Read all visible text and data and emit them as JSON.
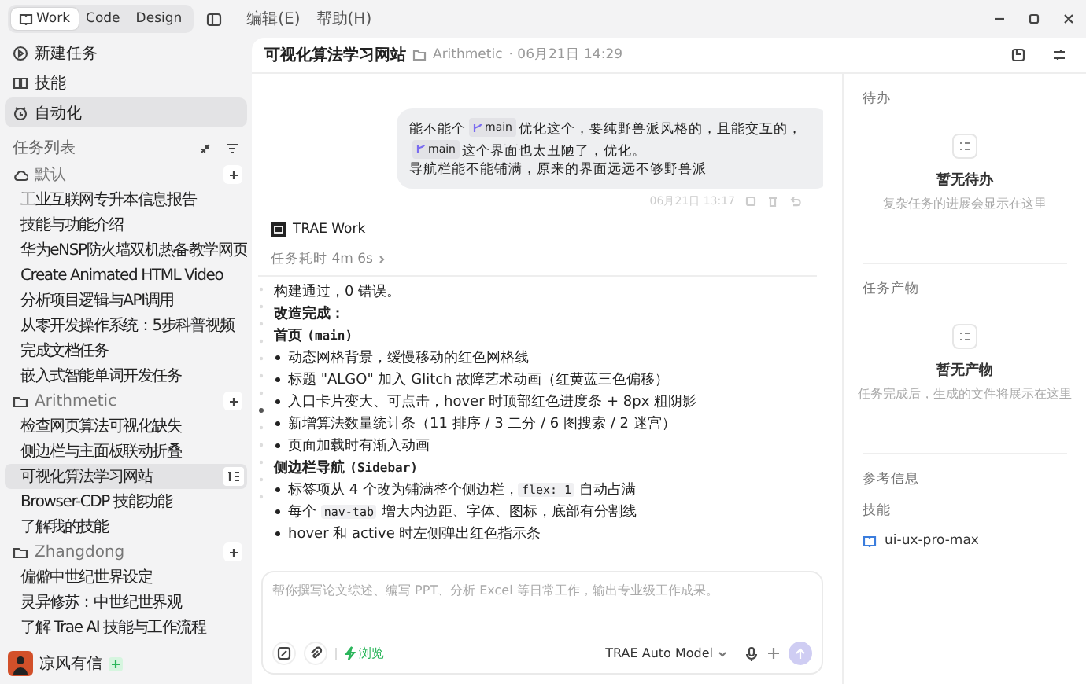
{
  "mode_tabs": [
    {
      "label": "Work",
      "selected": true
    },
    {
      "label": "Code",
      "selected": false
    },
    {
      "label": "Design",
      "selected": false
    }
  ],
  "menu": [
    "编辑(E)",
    "帮助(H)"
  ],
  "nav": [
    {
      "label": "新建任务",
      "kind": "new",
      "selected": false
    },
    {
      "label": "技能",
      "kind": "skills",
      "selected": false
    },
    {
      "label": "自动化",
      "kind": "auto",
      "selected": true
    }
  ],
  "task_list": {
    "title": "任务列表",
    "groups": [
      {
        "name": "默认",
        "kind": "cloud",
        "tasks": [
          {
            "label": "工业互联网专升本信息报告",
            "selected": false
          },
          {
            "label": "技能与功能介绍",
            "selected": false
          },
          {
            "label": "华为eNSP防火墙双机热备教学网页",
            "selected": false
          },
          {
            "label": "Create Animated HTML Video",
            "selected": false
          },
          {
            "label": "分析项目逻辑与API调用",
            "selected": false
          },
          {
            "label": "从零开发操作系统：5步科普视频",
            "selected": false
          },
          {
            "label": "完成文档任务",
            "selected": false
          },
          {
            "label": "嵌入式智能单词开发任务",
            "selected": false
          }
        ]
      },
      {
        "name": "Arithmetic",
        "kind": "folder",
        "tasks": [
          {
            "label": "检查网页算法可视化缺失",
            "selected": false
          },
          {
            "label": "侧边栏与主面板联动折叠",
            "selected": false
          },
          {
            "label": "可视化算法学习网站",
            "selected": true
          },
          {
            "label": "Browser-CDP 技能功能",
            "selected": false
          },
          {
            "label": "了解我的技能",
            "selected": false
          }
        ]
      },
      {
        "name": "Zhangdong",
        "kind": "folder",
        "tasks": [
          {
            "label": "偏僻中世纪世界设定",
            "selected": false
          },
          {
            "label": "灵异修苏：中世纪世界观",
            "selected": false
          },
          {
            "label": "了解 Trae AI 技能与工作流程",
            "selected": false
          }
        ]
      }
    ]
  },
  "user": {
    "name": "凉风有信"
  },
  "header": {
    "title": "可视化算法学习网站",
    "folder": "Arithmetic",
    "time": "· 06月21日 14:29"
  },
  "user_message": {
    "lines": [
      [
        {
          "kind": "text",
          "text": "能不能个"
        },
        {
          "kind": "chip",
          "text": "main"
        },
        {
          "kind": "text",
          "text": "优化这个，要纯野兽派风格的，且能交互的，"
        },
        {
          "kind": "chip",
          "text": "main"
        },
        {
          "kind": "text",
          "text": "这个界面也太丑陋了，优化。"
        }
      ],
      [
        {
          "kind": "text",
          "text": "导航栏能不能铺满，原来的界面远远不够野兽派"
        }
      ]
    ],
    "time": "06月21日 13:17"
  },
  "agent": {
    "name": "TRAE Work",
    "duration": "任务耗时 4m 6s"
  },
  "response": [
    {
      "kind": "para",
      "parts": [
        {
          "kind": "text",
          "text": "构建通过，0 错误。"
        }
      ]
    },
    {
      "kind": "heading",
      "parts": [
        {
          "kind": "text",
          "text": "改造完成："
        }
      ]
    },
    {
      "kind": "heading",
      "parts": [
        {
          "kind": "text",
          "text": "首页 "
        },
        {
          "kind": "mono",
          "text": "(main)"
        }
      ]
    },
    {
      "kind": "bullet",
      "parts": [
        {
          "kind": "text",
          "text": "动态网格背景，缓慢移动的红色网格线"
        }
      ]
    },
    {
      "kind": "bullet",
      "parts": [
        {
          "kind": "text",
          "text": "标题 \"ALGO\" 加入 Glitch 故障艺术动画（红黄蓝三色偏移）"
        }
      ]
    },
    {
      "kind": "bullet",
      "parts": [
        {
          "kind": "text",
          "text": "入口卡片变大、可点击，hover 时顶部红色进度条 + 8px 粗阴影"
        }
      ]
    },
    {
      "kind": "bullet",
      "parts": [
        {
          "kind": "text",
          "text": "新增算法数量统计条（11 排序 / 3 二分 / 6 图搜索 / 2 迷宫）"
        }
      ]
    },
    {
      "kind": "bullet",
      "parts": [
        {
          "kind": "text",
          "text": "页面加载时有渐入动画"
        }
      ]
    },
    {
      "kind": "heading",
      "parts": [
        {
          "kind": "text",
          "text": "侧边栏导航 "
        },
        {
          "kind": "mono",
          "text": "(Sidebar)"
        }
      ]
    },
    {
      "kind": "bullet",
      "parts": [
        {
          "kind": "text",
          "text": "标签项从 4 个改为铺满整个侧边栏，"
        },
        {
          "kind": "code",
          "text": "flex: 1"
        },
        {
          "kind": "text",
          "text": " 自动占满"
        }
      ]
    },
    {
      "kind": "bullet",
      "parts": [
        {
          "kind": "text",
          "text": "每个 "
        },
        {
          "kind": "code",
          "text": "nav-tab"
        },
        {
          "kind": "text",
          "text": " 增大内边距、字体、图标，底部有分割线"
        }
      ]
    },
    {
      "kind": "bullet",
      "parts": [
        {
          "kind": "text",
          "text": "hover 和 active 时左侧弹出红色指示条"
        }
      ]
    }
  ],
  "composer": {
    "placeholder": "帮你撰写论文综述、编写 PPT、分析 Excel 等日常工作，输出专业级工作成果。",
    "skill": "浏览",
    "model": "TRAE Auto Model"
  },
  "side_panel": [
    {
      "kind": "empty",
      "title": "待办",
      "empty_title": "暂无待办",
      "empty_text": "复杂任务的进展会显示在这里"
    },
    {
      "kind": "empty",
      "title": "任务产物",
      "empty_title": "暂无产物",
      "empty_text": "任务完成后，生成的文件将展示在这里"
    },
    {
      "kind": "refs",
      "title": "参考信息",
      "label": "技能",
      "link": "ui-ux-pro-max"
    }
  ]
}
